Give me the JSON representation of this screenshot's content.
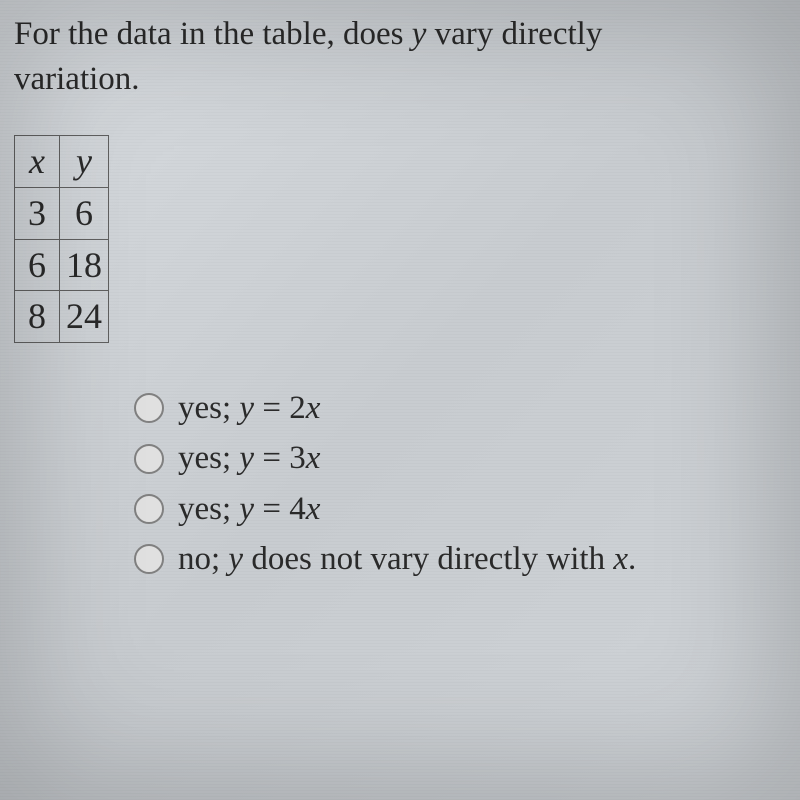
{
  "question": {
    "line1_prefix": "For the data in the table, does ",
    "line1_var": "y",
    "line1_suffix": " vary directly",
    "line2": "variation."
  },
  "table": {
    "headers": {
      "x": "x",
      "y": "y"
    },
    "rows": [
      {
        "x": "3",
        "y": "6"
      },
      {
        "x": "6",
        "y": "18"
      },
      {
        "x": "8",
        "y": "24"
      }
    ]
  },
  "options": [
    {
      "prefix": "yes; ",
      "var": "y",
      "mid": " = 2",
      "var2": "x",
      "suffix": ""
    },
    {
      "prefix": "yes; ",
      "var": "y",
      "mid": " = 3",
      "var2": "x",
      "suffix": ""
    },
    {
      "prefix": "yes; ",
      "var": "y",
      "mid": " = 4",
      "var2": "x",
      "suffix": ""
    },
    {
      "prefix": "no; ",
      "var": "y",
      "mid": " does not vary directly with ",
      "var2": "x",
      "suffix": "."
    }
  ],
  "chart_data": {
    "type": "table",
    "columns": [
      "x",
      "y"
    ],
    "rows": [
      [
        3,
        6
      ],
      [
        6,
        18
      ],
      [
        8,
        24
      ]
    ]
  }
}
